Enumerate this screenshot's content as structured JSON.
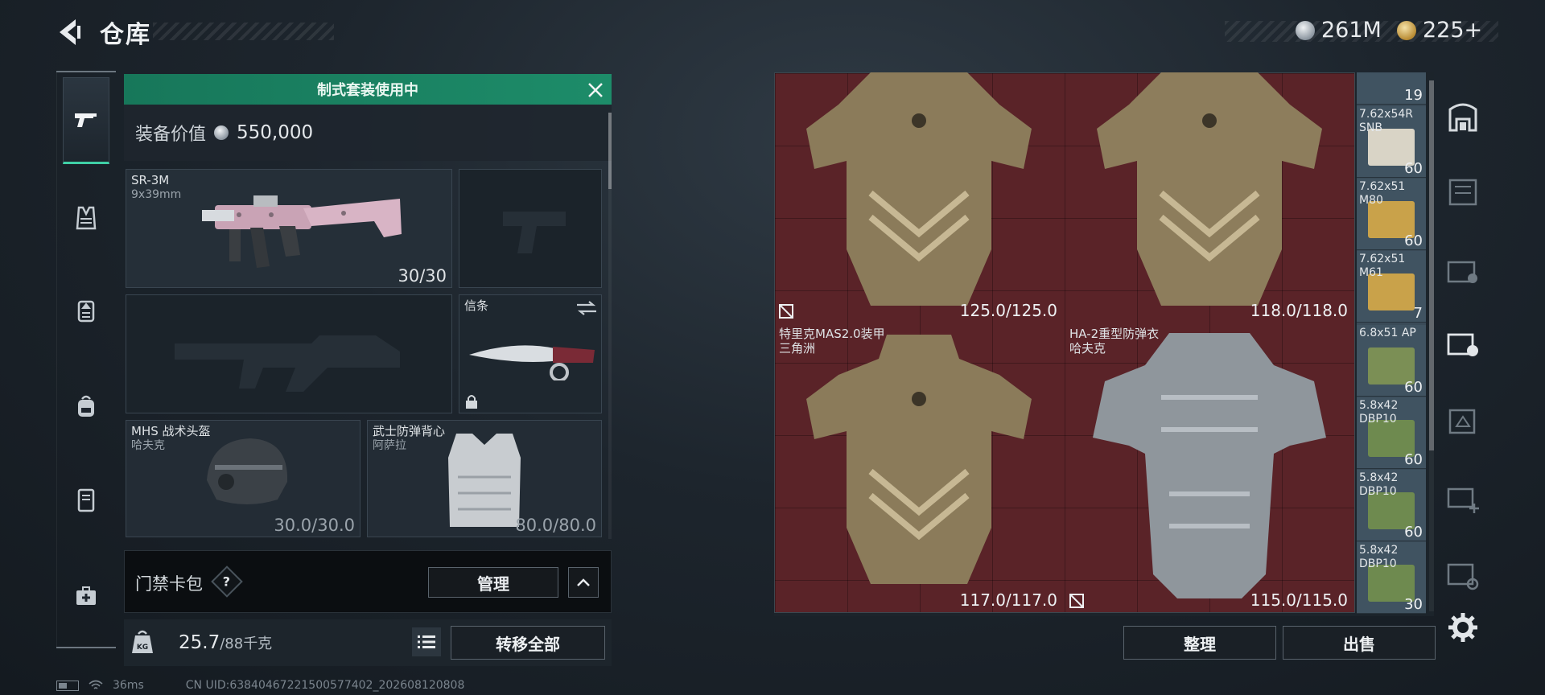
{
  "header": {
    "title": "仓库",
    "currencies": [
      {
        "name": "silver",
        "value": "261M",
        "color": "#b8c0c7"
      },
      {
        "name": "gold",
        "value": "225+",
        "color": "#d3a94a"
      }
    ]
  },
  "left_nav": {
    "items": [
      "gun-icon",
      "vest-icon",
      "backpack-icon",
      "bag-icon",
      "locker-icon",
      "medkit-icon"
    ],
    "active": "gun-icon"
  },
  "loadout": {
    "banner": "制式套装使用中",
    "value_label": "装备价值",
    "value": "550,000",
    "slots": {
      "primary": {
        "name": "SR-3M",
        "sub": "9x39mm",
        "value": "30/30"
      },
      "pistol": {
        "name": "",
        "value": ""
      },
      "secondary": {
        "name": "",
        "value": ""
      },
      "melee": {
        "name": "信条"
      },
      "helmet": {
        "name": "MHS 战术头盔",
        "sub": "哈夫克",
        "value": "30.0/30.0"
      },
      "armor": {
        "name": "武士防弹背心",
        "sub": "阿萨拉",
        "value": "80.0/80.0"
      }
    },
    "keycard_label": "门禁卡包",
    "keycard_help": "?",
    "manage_label": "管理",
    "weight": "25.7",
    "weight_max": "/88千克",
    "weight_icon_text": "KG",
    "transfer_label": "转移全部"
  },
  "status": {
    "ping": "36ms",
    "uid": "CN UID:63840467221500577402_202608120808"
  },
  "stash": {
    "items": [
      {
        "name": "",
        "name2": "",
        "value": "125.0/125.0",
        "insured": true
      },
      {
        "name": "",
        "name2": "",
        "value": "118.0/118.0",
        "insured": false
      },
      {
        "name": "特里克MAS2.0装甲",
        "name2": "三角洲",
        "value": "117.0/117.0",
        "insured": false
      },
      {
        "name": "HA-2重型防弹衣",
        "name2": "哈夫克",
        "value": "115.0/115.0",
        "insured": true
      }
    ],
    "ammo": [
      {
        "name": "",
        "count": "19",
        "color": "#3a4b58"
      },
      {
        "name": "7.62x54R SNB",
        "count": "60",
        "color": "#d9d4c6"
      },
      {
        "name": "7.62x51 M80",
        "count": "60",
        "color": "#c9a24a"
      },
      {
        "name": "7.62x51 M61",
        "count": "7",
        "color": "#c9a24a"
      },
      {
        "name": "6.8x51 AP",
        "count": "60",
        "color": "#7b8f55"
      },
      {
        "name": "5.8x42 DBP10",
        "count": "60",
        "color": "#6e8a4f"
      },
      {
        "name": "5.8x42 DBP10",
        "count": "60",
        "color": "#6e8a4f"
      },
      {
        "name": "5.8x42 DBP10",
        "count": "30",
        "color": "#6e8a4f"
      }
    ],
    "sort_label": "整理",
    "sell_label": "出售"
  },
  "right_nav": {
    "items": [
      "stash-icon",
      "gti-icon",
      "gti-locked-icon",
      "iv-gear-icon",
      "iv-icon",
      "iv-add-icon",
      "gti-add-icon",
      "settings-icon"
    ]
  }
}
